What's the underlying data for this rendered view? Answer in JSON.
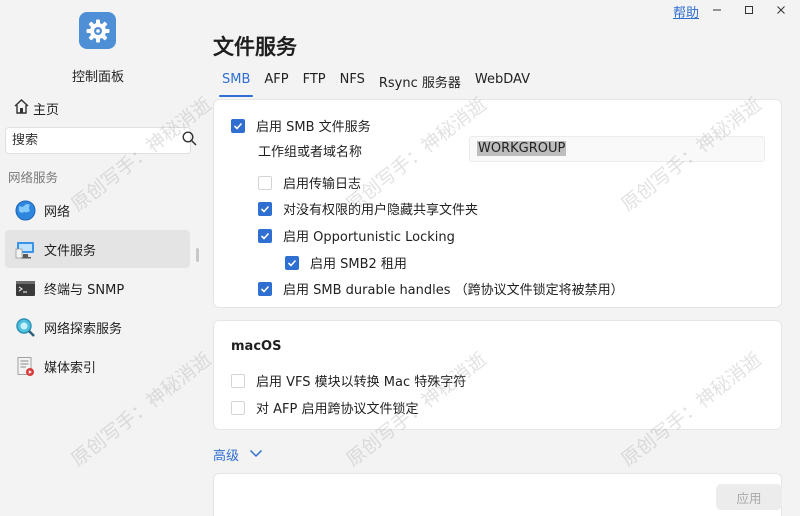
{
  "titlebar": {
    "help": "帮助",
    "controls": [
      "minimize-icon",
      "maximize-icon",
      "close-icon"
    ]
  },
  "sidebar": {
    "app_icon": "gear-icon",
    "app_title": "控制面板",
    "home_label": "主页",
    "search_placeholder": "搜索",
    "section_title": "网络服务",
    "items": [
      {
        "label": "网络",
        "icon": "globe-icon",
        "active": false
      },
      {
        "label": "文件服务",
        "icon": "file-service-icon",
        "active": true
      },
      {
        "label": "终端与 SNMP",
        "icon": "terminal-icon",
        "active": false
      },
      {
        "label": "网络探索服务",
        "icon": "network-discovery-icon",
        "active": false
      },
      {
        "label": "媒体索引",
        "icon": "media-index-icon",
        "active": false
      }
    ]
  },
  "main": {
    "title": "文件服务",
    "tabs": [
      "SMB",
      "AFP",
      "FTP",
      "NFS",
      "Rsync 服务器",
      "WebDAV"
    ],
    "active_tab": "SMB",
    "smb": {
      "enable_label": "启用 SMB 文件服务",
      "enable_checked": true,
      "workgroup_label": "工作组或者域名称",
      "workgroup_value": "WORKGROUP",
      "options": [
        {
          "label": "启用传输日志",
          "checked": false
        },
        {
          "label": "对没有权限的用户隐藏共享文件夹",
          "checked": true
        },
        {
          "label": "启用 Opportunistic Locking",
          "checked": true
        },
        {
          "label": "启用 SMB2 租用",
          "checked": true
        },
        {
          "label": "启用 SMB durable handles （跨协议文件锁定将被禁用）",
          "checked": true
        }
      ]
    },
    "macos": {
      "title": "macOS",
      "options": [
        {
          "label": "启用 VFS 模块以转换 Mac 特殊字符",
          "checked": false
        },
        {
          "label": "对 AFP 启用跨协议文件锁定",
          "checked": false
        }
      ]
    },
    "advanced_label": "高级",
    "apply_label": "应用"
  },
  "watermark": "原创写手：神秘消逝",
  "colors": {
    "accent": "#2f6fd1",
    "sidebar_bg": "#f3f3f3",
    "active_item_bg": "#e4e4e4",
    "card_bg": "#ffffff"
  }
}
